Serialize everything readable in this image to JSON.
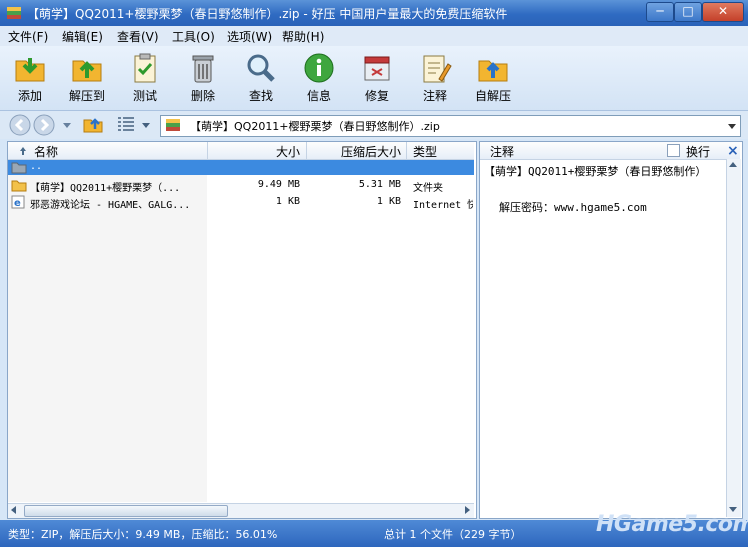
{
  "window": {
    "title": "【萌学】QQ2011+樱野栗梦（春日野悠制作）.zip - 好压 中国用户量最大的免费压缩软件",
    "min": "─",
    "max": "□",
    "close": "✕"
  },
  "menu": [
    "文件(F)",
    "编辑(E)",
    "查看(V)",
    "工具(O)",
    "选项(W)",
    "帮助(H)"
  ],
  "toolbar": [
    {
      "label": "添加",
      "icon": "add-icon"
    },
    {
      "label": "解压到",
      "icon": "extract-icon"
    },
    {
      "label": "测试",
      "icon": "test-icon"
    },
    {
      "label": "删除",
      "icon": "delete-icon"
    },
    {
      "label": "查找",
      "icon": "search-icon"
    },
    {
      "label": "信息",
      "icon": "info-icon"
    },
    {
      "label": "修复",
      "icon": "repair-icon"
    },
    {
      "label": "注释",
      "icon": "comment-icon"
    },
    {
      "label": "自解压",
      "icon": "sfx-icon"
    }
  ],
  "address": {
    "path": "【萌学】QQ2011+樱野栗梦（春日野悠制作）.zip"
  },
  "columns": {
    "name": "名称",
    "size": "大小",
    "packed": "压缩后大小",
    "type": "类型"
  },
  "files": [
    {
      "name": "..",
      "size": "",
      "packed": "",
      "type": ""
    },
    {
      "name": "【萌学】QQ2011+樱野栗梦（...",
      "size": "9.49 MB",
      "packed": "5.31 MB",
      "type": "文件夹"
    },
    {
      "name": "邪恶游戏论坛 - HGAME、GALG...",
      "size": "1 KB",
      "packed": "1 KB",
      "type": "Internet 快"
    }
  ],
  "comment": {
    "header": "注释",
    "wrap_label": "换行",
    "close": "×",
    "line1": "【萌学】QQ2011+樱野栗梦（春日野悠制作）",
    "line2": "解压密码：www.hgame5.com"
  },
  "status": {
    "left": "类型：ZIP，解压后大小：9.49 MB，压缩比：56.01%",
    "right": "总计 1 个文件（229 字节）"
  },
  "watermark": "HGame5.com",
  "colors": {
    "accent": "#2f6bc2",
    "selection": "#3c8ae0"
  }
}
